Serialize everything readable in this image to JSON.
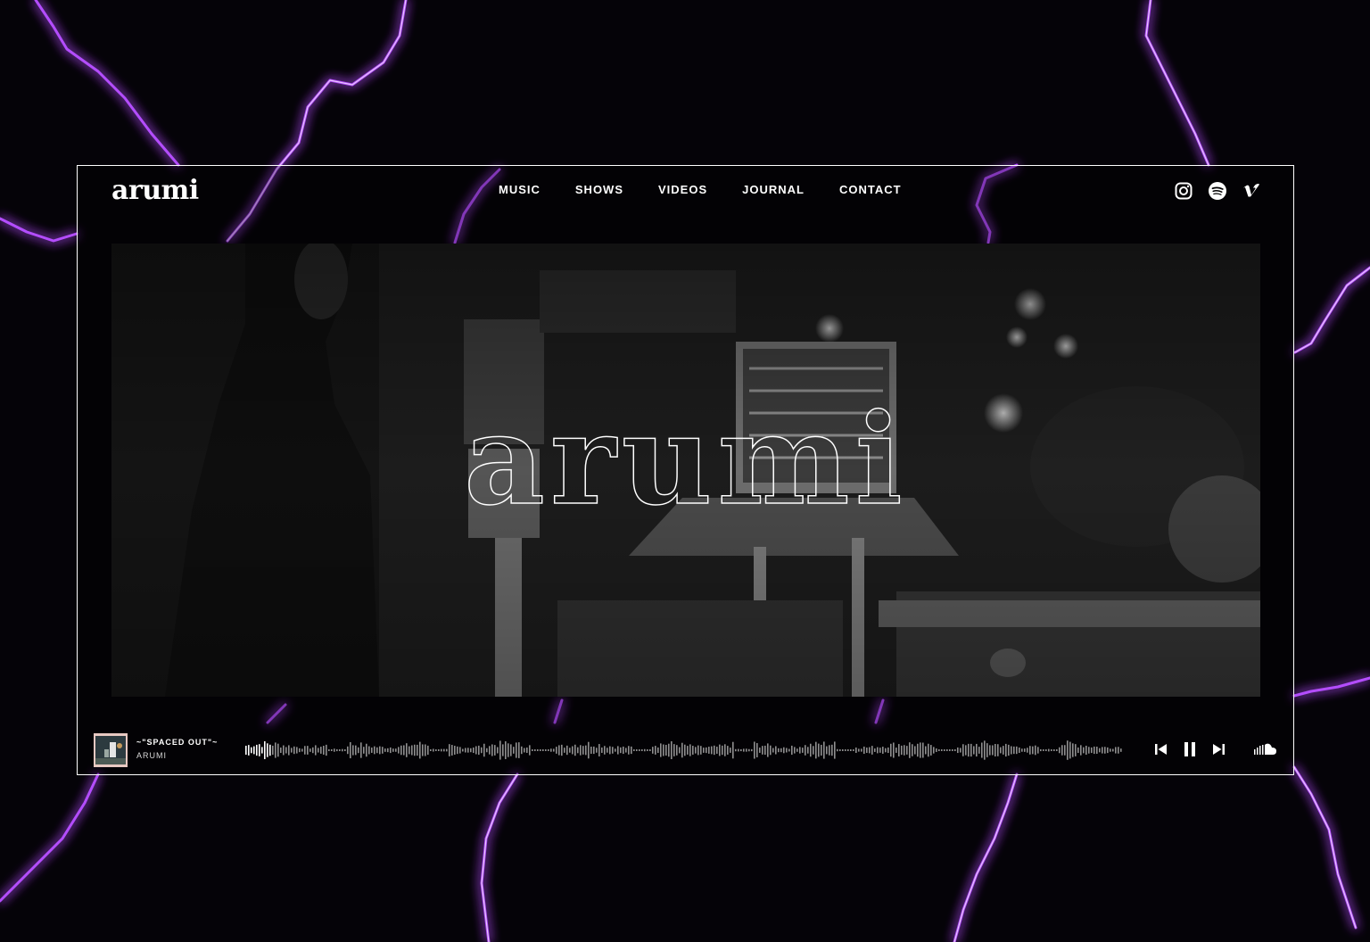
{
  "site": {
    "logo": "arumi",
    "hero_title": "arumi"
  },
  "nav": [
    {
      "label": "MUSIC"
    },
    {
      "label": "SHOWS"
    },
    {
      "label": "VIDEOS"
    },
    {
      "label": "JOURNAL"
    },
    {
      "label": "CONTACT"
    }
  ],
  "social": [
    "instagram-icon",
    "spotify-icon",
    "vimeo-icon"
  ],
  "player": {
    "track_title": "~\"SPACED OUT\"~",
    "artist": "ARUMI",
    "progress": 0.03,
    "controls": [
      "previous-icon",
      "pause-icon",
      "next-icon"
    ],
    "source_icon": "soundcloud-icon"
  },
  "colors": {
    "background": "#050308",
    "lightning": "#b44dff",
    "frame_border": "#ffffff",
    "text": "#ffffff"
  }
}
